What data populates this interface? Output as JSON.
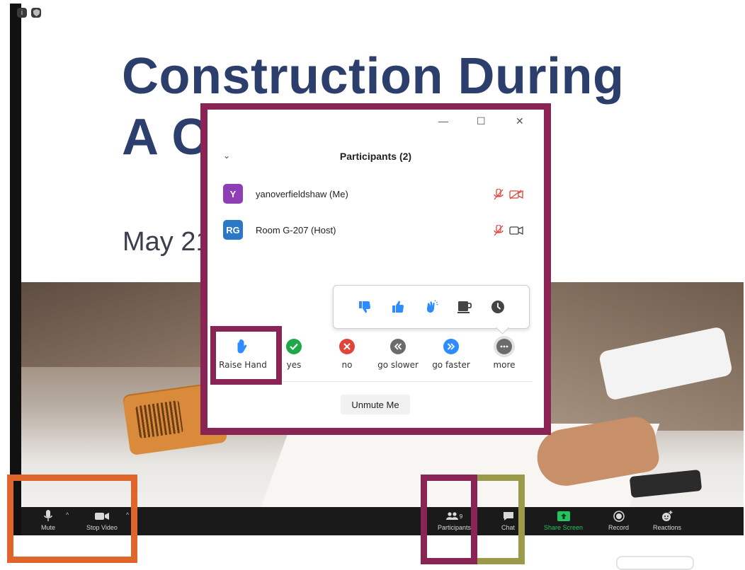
{
  "slide": {
    "title_line1": "Construction During",
    "title_line2": "A C",
    "date": "May 21"
  },
  "participants_panel": {
    "title": "Participants (2)",
    "participants": [
      {
        "initials": "Y",
        "name": "yanoverfieldshaw (Me)",
        "avatar_color": "#8e3fb5"
      },
      {
        "initials": "RG",
        "name": "Room G-207 (Host)",
        "avatar_color": "#2b78c6"
      }
    ],
    "feedback": [
      {
        "label": "Raise Hand",
        "icon": "raise-hand-icon"
      },
      {
        "label": "yes",
        "icon": "check-icon"
      },
      {
        "label": "no",
        "icon": "x-icon"
      },
      {
        "label": "go slower",
        "icon": "rewind-icon"
      },
      {
        "label": "go faster",
        "icon": "fast-forward-icon"
      },
      {
        "label": "more",
        "icon": "more-icon"
      }
    ],
    "more_reactions": [
      "thumbs-down-icon",
      "thumbs-up-icon",
      "clap-icon",
      "coffee-icon",
      "clock-icon"
    ],
    "unmute_label": "Unmute Me"
  },
  "toolbar": {
    "mute": "Mute",
    "stop_video": "Stop Video",
    "participants": "Participants",
    "participants_count": "9",
    "chat": "Chat",
    "share_screen": "Share Screen",
    "record": "Record",
    "reactions": "Reactions"
  },
  "colors": {
    "highlight_purple": "#8a2454",
    "highlight_orange": "#e0652a",
    "highlight_olive": "#9a9a4a",
    "accent_blue": "#2d8cff"
  }
}
